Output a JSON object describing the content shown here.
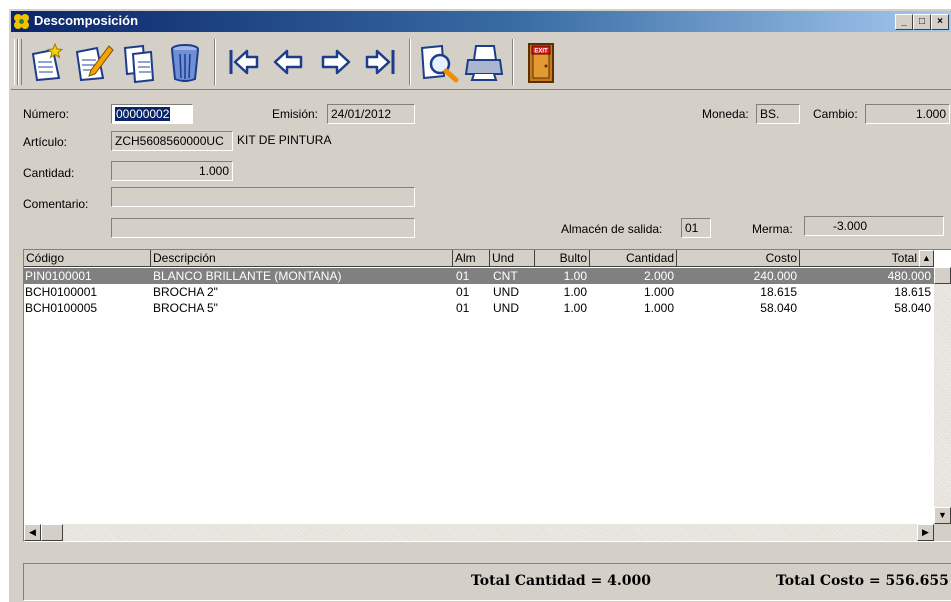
{
  "window": {
    "title": "Descomposición"
  },
  "toolbar": {
    "buttons": [
      "new-icon",
      "edit-icon",
      "copy-icon",
      "delete-icon",
      "first-icon",
      "previous-icon",
      "next-icon",
      "last-icon",
      "search-icon",
      "print-icon",
      "exit-icon"
    ],
    "exit_text": "EXIT"
  },
  "form": {
    "numero_label": "Número:",
    "numero": "00000002",
    "emision_label": "Emisión:",
    "emision": "24/01/2012",
    "moneda_label": "Moneda:",
    "moneda": "BS.",
    "cambio_label": "Cambio:",
    "cambio": "1.000",
    "articulo_label": "Artículo:",
    "articulo_codigo": "ZCH5608560000UC",
    "articulo_desc": "KIT DE PINTURA",
    "cantidad_label": "Cantidad:",
    "cantidad": "1.000",
    "comentario_label": "Comentario:",
    "comentario1": "",
    "comentario2": "",
    "almacen_label": "Almacén de salida:",
    "almacen": "01",
    "merma_label": "Merma:",
    "merma": "-3.000"
  },
  "grid": {
    "columns": [
      "Código",
      "Descripción",
      "Alm",
      "Und",
      "Bulto",
      "Cantidad",
      "Costo",
      "Total"
    ],
    "rows": [
      [
        "PIN0100001",
        "BLANCO BRILLANTE (MONTANA)",
        "01",
        "CNT",
        "1.00",
        "2.000",
        "240.000",
        "480.000"
      ],
      [
        "BCH0100001",
        "BROCHA 2\"",
        "01",
        "UND",
        "1.00",
        "1.000",
        "18.615",
        "18.615"
      ],
      [
        "BCH0100005",
        "BROCHA 5\"",
        "01",
        "UND",
        "1.00",
        "1.000",
        "58.040",
        "58.040"
      ]
    ]
  },
  "footer": {
    "total_cantidad": "Total Cantidad = 4.000",
    "total_costo": "Total Costo = 556.655"
  },
  "colors": {
    "title_start": "#0a246a",
    "title_end": "#a6caf0",
    "selected_row": "#808080",
    "face": "#d4d0c8"
  }
}
